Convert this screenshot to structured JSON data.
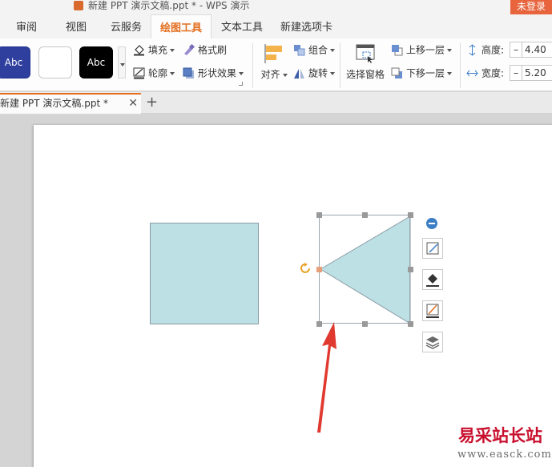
{
  "window": {
    "title": "新建 PPT 演示文稿.ppt * - WPS 演示",
    "login_label": "未登录"
  },
  "ribbon_tabs": [
    {
      "label": "审阅"
    },
    {
      "label": "视图"
    },
    {
      "label": "云服务"
    },
    {
      "label": "绘图工具"
    },
    {
      "label": "文本工具"
    },
    {
      "label": "新建选项卡"
    }
  ],
  "active_tab": "绘图工具",
  "shape_styles": [
    {
      "label": "Abc"
    },
    {
      "label": ""
    },
    {
      "label": "Abc"
    }
  ],
  "ribbon": {
    "fill_label": "填充",
    "format_painter_label": "格式刷",
    "outline_label": "轮廓",
    "shape_effect_label": "形状效果",
    "align_label": "对齐",
    "group_label": "组合",
    "rotate_label": "旋转",
    "selection_pane_label": "选择窗格",
    "bring_forward_label": "上移一层",
    "send_backward_label": "下移一层",
    "height_label": "高度:",
    "height_value": "4.40",
    "width_label": "宽度:",
    "width_value": "5.20"
  },
  "document_tab": {
    "label": "新建 PPT 演示文稿.ppt *"
  },
  "watermark": {
    "text": "易采站长站",
    "url": "www.easck.com"
  },
  "colors": {
    "accent": "#e36e1f",
    "shape_fill": "#bce0e3",
    "arrow": "#e03a30"
  }
}
